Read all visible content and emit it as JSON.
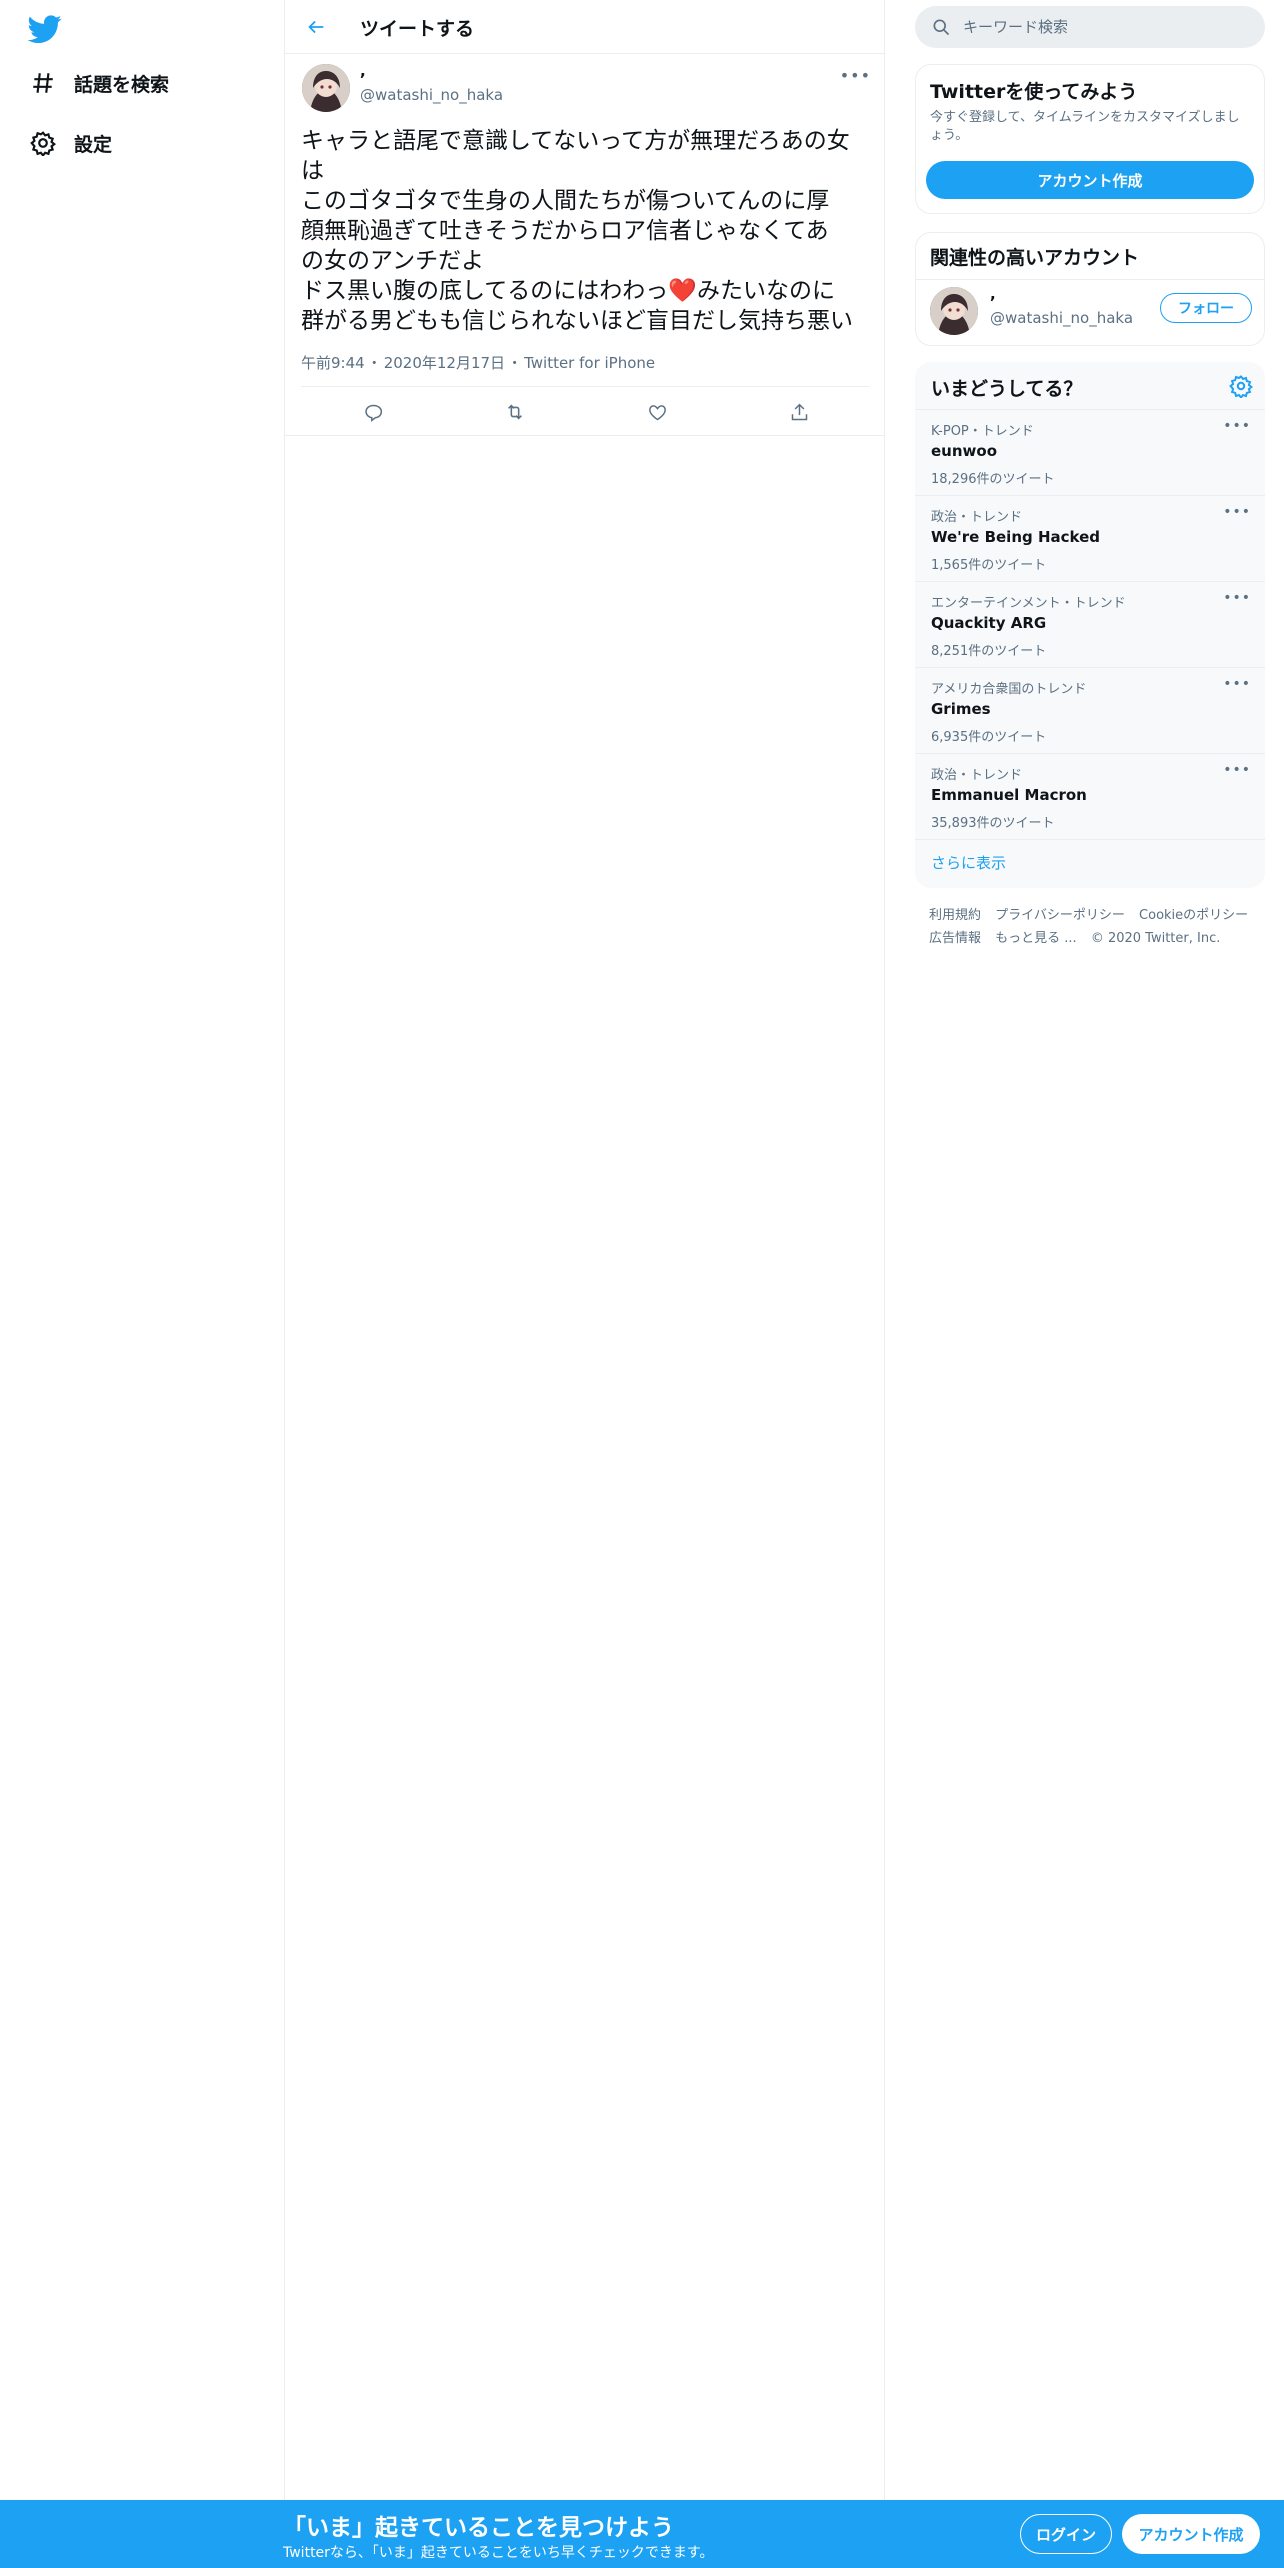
{
  "nav": {
    "items": [
      {
        "label": "話題を検索",
        "icon": "hashtag-icon"
      },
      {
        "label": "設定",
        "icon": "gear-icon"
      }
    ]
  },
  "header": {
    "title": "ツイートする"
  },
  "tweet": {
    "display_name": ",",
    "handle": "@watashi_no_haka",
    "text_lines": [
      "キャラと語尾で意識してないって方が無理だろあの女",
      "は",
      "このゴタゴタで生身の人間たちが傷ついてんのに厚",
      "顔無恥過ぎて吐きそうだからロア信者じゃなくてあ",
      "の女のアンチだよ",
      "ドス黒い腹の底してるのにはわわっ",
      "みたいなのに",
      "群がる男どもも信じられないほど盲目だし気持ち悪い"
    ],
    "heart_emoji": "❤️",
    "time": "午前9:44",
    "date": "2020年12月17日",
    "source": "Twitter for iPhone",
    "separator": "・"
  },
  "search": {
    "placeholder": "キーワード検索"
  },
  "signup_card": {
    "title": "Twitterを使ってみよう",
    "desc": "今すぐ登録して、タイムラインをカスタマイズしましょう。",
    "button": "アカウント作成"
  },
  "related": {
    "title": "関連性の高いアカウント",
    "name": ",",
    "handle": "@watashi_no_haka",
    "follow": "フォロー"
  },
  "trends": {
    "title": "いまどうしてる？",
    "items": [
      {
        "category": "K-POP・トレンド",
        "name": "eunwoo",
        "count": "18,296件のツイート"
      },
      {
        "category": "政治・トレンド",
        "name": "We're Being Hacked",
        "count": "1,565件のツイート"
      },
      {
        "category": "エンターテインメント・トレンド",
        "name": "Quackity ARG",
        "count": "8,251件のツイート"
      },
      {
        "category": "アメリカ合衆国のトレンド",
        "name": "Grimes",
        "count": "6,935件のツイート"
      },
      {
        "category": "政治・トレンド",
        "name": "Emmanuel Macron",
        "count": "35,893件のツイート"
      }
    ],
    "show_more": "さらに表示"
  },
  "footer": {
    "terms": "利用規約",
    "privacy": "プライバシーポリシー",
    "cookie": "Cookieのポリシー",
    "ads": "広告情報",
    "more": "もっと見る ...",
    "copyright": "© 2020 Twitter, Inc."
  },
  "bottom_bar": {
    "title": "「いま」起きていることを見つけよう",
    "subtitle": "Twitterなら、「いま」起きていることをいち早くチェックできます。",
    "login": "ログイン",
    "signup": "アカウント作成"
  },
  "colors": {
    "accent": "#1da1f2",
    "text_secondary": "#5b7083",
    "border": "#ebeef0",
    "heart": "#e0245e"
  }
}
